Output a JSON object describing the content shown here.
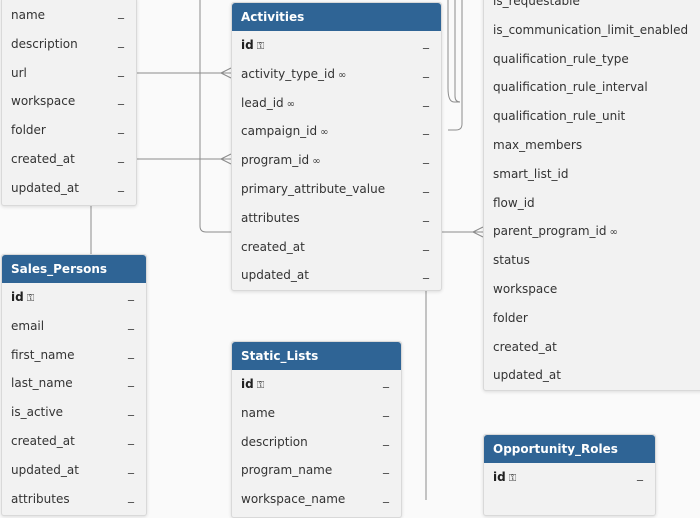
{
  "tables": {
    "top_left": {
      "fields": [
        {
          "name": "name"
        },
        {
          "name": "description"
        },
        {
          "name": "url"
        },
        {
          "name": "workspace"
        },
        {
          "name": "folder"
        },
        {
          "name": "created_at"
        },
        {
          "name": "updated_at"
        }
      ],
      "dash": "_"
    },
    "activities": {
      "title": "Activities",
      "fields": [
        {
          "name": "id",
          "key": "primary"
        },
        {
          "name": "activity_type_id",
          "key": "foreign"
        },
        {
          "name": "lead_id",
          "key": "foreign"
        },
        {
          "name": "campaign_id",
          "key": "foreign"
        },
        {
          "name": "program_id",
          "key": "foreign"
        },
        {
          "name": "primary_attribute_value"
        },
        {
          "name": "attributes"
        },
        {
          "name": "created_at"
        },
        {
          "name": "updated_at"
        }
      ]
    },
    "programs": {
      "fields": [
        {
          "name": "is_requestable"
        },
        {
          "name": "is_communication_limit_enabled"
        },
        {
          "name": "qualification_rule_type"
        },
        {
          "name": "qualification_rule_interval"
        },
        {
          "name": "qualification_rule_unit"
        },
        {
          "name": "max_members"
        },
        {
          "name": "smart_list_id"
        },
        {
          "name": "flow_id"
        },
        {
          "name": "parent_program_id",
          "key": "foreign"
        },
        {
          "name": "status"
        },
        {
          "name": "workspace"
        },
        {
          "name": "folder"
        },
        {
          "name": "created_at"
        },
        {
          "name": "updated_at"
        }
      ]
    },
    "sales_persons": {
      "title": "Sales_Persons",
      "fields": [
        {
          "name": "id",
          "key": "primary"
        },
        {
          "name": "email"
        },
        {
          "name": "first_name"
        },
        {
          "name": "last_name"
        },
        {
          "name": "is_active"
        },
        {
          "name": "created_at"
        },
        {
          "name": "updated_at"
        },
        {
          "name": "attributes"
        }
      ]
    },
    "static_lists": {
      "title": "Static_Lists",
      "fields": [
        {
          "name": "id",
          "key": "primary"
        },
        {
          "name": "name"
        },
        {
          "name": "description"
        },
        {
          "name": "program_name"
        },
        {
          "name": "workspace_name"
        }
      ]
    },
    "opportunity_roles": {
      "title": "Opportunity_Roles",
      "fields": [
        {
          "name": "id",
          "key": "primary"
        }
      ]
    }
  },
  "icons": {
    "primary_key": "key-icon",
    "foreign_key": "link-icon"
  },
  "colors": {
    "header_bg": "#2f6495",
    "header_text": "#ffffff",
    "table_bg": "#f2f2f2",
    "connector": "#8c8c8c"
  }
}
